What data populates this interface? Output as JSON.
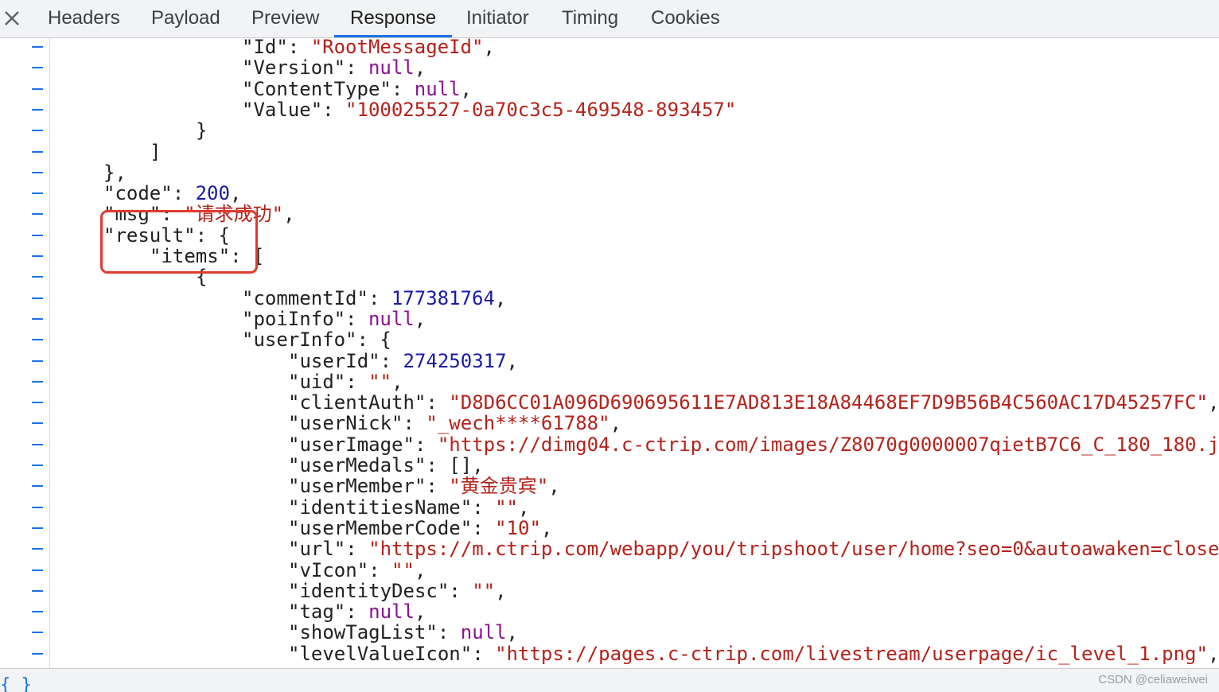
{
  "tabs": [
    {
      "label": "Headers"
    },
    {
      "label": "Payload"
    },
    {
      "label": "Preview"
    },
    {
      "label": "Response",
      "active": true
    },
    {
      "label": "Initiator"
    },
    {
      "label": "Timing"
    },
    {
      "label": "Cookies"
    }
  ],
  "colors": {
    "accent": "#1a73e8",
    "string": "#b3221b",
    "number": "#1a1aa6",
    "null": "#881391",
    "highlight": "#e03a2f"
  },
  "lines": [
    {
      "tokens": [
        {
          "t": "k",
          "v": "\"Id\": "
        },
        {
          "t": "s",
          "v": "\"RootMessageId\""
        },
        {
          "t": "k",
          "v": ","
        }
      ]
    },
    {
      "tokens": [
        {
          "t": "k",
          "v": "\"Version\": "
        },
        {
          "t": "nl",
          "v": "null"
        },
        {
          "t": "k",
          "v": ","
        }
      ]
    },
    {
      "tokens": [
        {
          "t": "k",
          "v": "\"ContentType\": "
        },
        {
          "t": "nl",
          "v": "null"
        },
        {
          "t": "k",
          "v": ","
        }
      ]
    },
    {
      "tokens": [
        {
          "t": "k",
          "v": "\"Value\": "
        },
        {
          "t": "s",
          "v": "\"100025527-0a70c3c5-469548-893457\""
        }
      ]
    },
    {
      "tokens": [
        {
          "t": "k",
          "v": "}"
        }
      ]
    },
    {
      "tokens": [
        {
          "t": "k",
          "v": "]"
        }
      ]
    },
    {
      "tokens": [
        {
          "t": "k",
          "v": "},"
        }
      ]
    },
    {
      "tokens": [
        {
          "t": "k",
          "v": "\"code\": "
        },
        {
          "t": "n",
          "v": "200"
        },
        {
          "t": "k",
          "v": ","
        }
      ]
    },
    {
      "tokens": [
        {
          "t": "k",
          "v": "\"msg\": "
        },
        {
          "t": "s",
          "v": "\"请求成功\""
        },
        {
          "t": "k",
          "v": ","
        }
      ]
    },
    {
      "tokens": [
        {
          "t": "k",
          "v": "\"result\": {"
        }
      ]
    },
    {
      "tokens": [
        {
          "t": "k",
          "v": "\"items\": ["
        }
      ]
    },
    {
      "tokens": [
        {
          "t": "k",
          "v": "{"
        }
      ]
    },
    {
      "tokens": [
        {
          "t": "k",
          "v": "\"commentId\": "
        },
        {
          "t": "n",
          "v": "177381764"
        },
        {
          "t": "k",
          "v": ","
        }
      ]
    },
    {
      "tokens": [
        {
          "t": "k",
          "v": "\"poiInfo\": "
        },
        {
          "t": "nl",
          "v": "null"
        },
        {
          "t": "k",
          "v": ","
        }
      ]
    },
    {
      "tokens": [
        {
          "t": "k",
          "v": "\"userInfo\": {"
        }
      ]
    },
    {
      "tokens": [
        {
          "t": "k",
          "v": "\"userId\": "
        },
        {
          "t": "n",
          "v": "274250317"
        },
        {
          "t": "k",
          "v": ","
        }
      ]
    },
    {
      "tokens": [
        {
          "t": "k",
          "v": "\"uid\": "
        },
        {
          "t": "s",
          "v": "\"\""
        },
        {
          "t": "k",
          "v": ","
        }
      ]
    },
    {
      "tokens": [
        {
          "t": "k",
          "v": "\"clientAuth\": "
        },
        {
          "t": "s",
          "v": "\"D8D6CC01A096D690695611E7AD813E18A84468EF7D9B56B4C560AC17D45257FC\""
        },
        {
          "t": "k",
          "v": ","
        }
      ]
    },
    {
      "tokens": [
        {
          "t": "k",
          "v": "\"userNick\": "
        },
        {
          "t": "s",
          "v": "\"_wech****61788\""
        },
        {
          "t": "k",
          "v": ","
        }
      ]
    },
    {
      "tokens": [
        {
          "t": "k",
          "v": "\"userImage\": "
        },
        {
          "t": "s",
          "v": "\"https://dimg04.c-ctrip.com/images/Z8070g0000007qietB7C6_C_180_180.j"
        }
      ]
    },
    {
      "tokens": [
        {
          "t": "k",
          "v": "\"userMedals\": [],"
        }
      ]
    },
    {
      "tokens": [
        {
          "t": "k",
          "v": "\"userMember\": "
        },
        {
          "t": "s",
          "v": "\"黄金贵宾\""
        },
        {
          "t": "k",
          "v": ","
        }
      ]
    },
    {
      "tokens": [
        {
          "t": "k",
          "v": "\"identitiesName\": "
        },
        {
          "t": "s",
          "v": "\"\""
        },
        {
          "t": "k",
          "v": ","
        }
      ]
    },
    {
      "tokens": [
        {
          "t": "k",
          "v": "\"userMemberCode\": "
        },
        {
          "t": "s",
          "v": "\"10\""
        },
        {
          "t": "k",
          "v": ","
        }
      ]
    },
    {
      "tokens": [
        {
          "t": "k",
          "v": "\"url\": "
        },
        {
          "t": "s",
          "v": "\"https://m.ctrip.com/webapp/you/tripshoot/user/home?seo=0&autoawaken=close"
        }
      ]
    },
    {
      "tokens": [
        {
          "t": "k",
          "v": "\"vIcon\": "
        },
        {
          "t": "s",
          "v": "\"\""
        },
        {
          "t": "k",
          "v": ","
        }
      ]
    },
    {
      "tokens": [
        {
          "t": "k",
          "v": "\"identityDesc\": "
        },
        {
          "t": "s",
          "v": "\"\""
        },
        {
          "t": "k",
          "v": ","
        }
      ]
    },
    {
      "tokens": [
        {
          "t": "k",
          "v": "\"tag\": "
        },
        {
          "t": "nl",
          "v": "null"
        },
        {
          "t": "k",
          "v": ","
        }
      ]
    },
    {
      "tokens": [
        {
          "t": "k",
          "v": "\"showTagList\": "
        },
        {
          "t": "nl",
          "v": "null"
        },
        {
          "t": "k",
          "v": ","
        }
      ]
    },
    {
      "tokens": [
        {
          "t": "k",
          "v": "\"levelValueIcon\": "
        },
        {
          "t": "s",
          "v": "\"https://pages.c-ctrip.com/livestream/userpage/ic_level_1.png\""
        },
        {
          "t": "k",
          "v": ","
        }
      ]
    }
  ],
  "footer": {
    "format_icon": "{ }",
    "watermark": "CSDN @celiaweiwei"
  }
}
